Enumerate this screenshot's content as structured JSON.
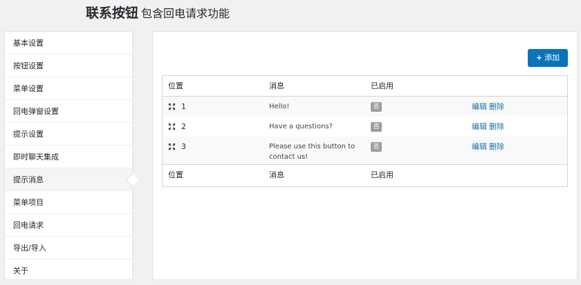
{
  "header": {
    "title": "联系按钮",
    "subtitle": "包含回电请求功能"
  },
  "sidebar": {
    "items": [
      {
        "label": "基本设置"
      },
      {
        "label": "按钮设置"
      },
      {
        "label": "菜单设置"
      },
      {
        "label": "回电弹窗设置"
      },
      {
        "label": "提示设置"
      },
      {
        "label": "即时聊天集成"
      },
      {
        "label": "提示消息",
        "active": true
      },
      {
        "label": "菜单项目"
      },
      {
        "label": "回电请求"
      },
      {
        "label": "导出/导入"
      },
      {
        "label": "关于"
      }
    ]
  },
  "toolbar": {
    "add_icon": "plus-icon",
    "add_label": "添加"
  },
  "table": {
    "columns": {
      "position": "位置",
      "message": "消息",
      "enabled": "已启用"
    },
    "rows": [
      {
        "position": "1",
        "message": "Hello!",
        "enabled": "否",
        "edit": "编辑",
        "delete": "删除"
      },
      {
        "position": "2",
        "message": "Have a questions?",
        "enabled": "否",
        "edit": "编辑",
        "delete": "删除"
      },
      {
        "position": "3",
        "message": "Please use this button to contact us!",
        "enabled": "否",
        "edit": "编辑",
        "delete": "删除"
      }
    ],
    "move_icon": "move-arrows-icon"
  },
  "colors": {
    "accent": "#0a73ba",
    "link": "#1d6fa5",
    "badge": "#9e9e9e"
  }
}
